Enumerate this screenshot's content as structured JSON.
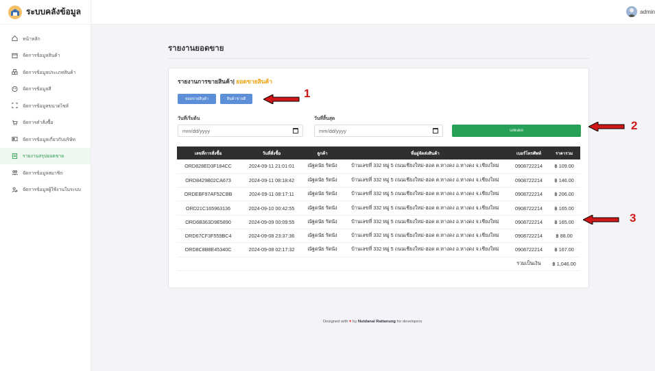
{
  "brand": {
    "title": "ระบบคลังข้อมูล"
  },
  "sidebar": {
    "items": [
      {
        "label": "หน้าหลัก",
        "icon": "home-icon",
        "active": false
      },
      {
        "label": "จัดการข้อมูลสินค้า",
        "icon": "box-icon",
        "active": false
      },
      {
        "label": "จัดการข้อมูลประเภทสินค้า",
        "icon": "boxes-icon",
        "active": false
      },
      {
        "label": "จัดการข้อมูลสี",
        "icon": "palette-icon",
        "active": false
      },
      {
        "label": "จัดการข้อมูลขนาดไซส์",
        "icon": "size-icon",
        "active": false
      },
      {
        "label": "จัดการคำสั่งซื้อ",
        "icon": "cart-icon",
        "active": false
      },
      {
        "label": "จัดการข้อมูลเกี่ยวกับบริษัท",
        "icon": "company-icon",
        "active": false
      },
      {
        "label": "รายงานสรุปยอดขาย",
        "icon": "report-icon",
        "active": true
      },
      {
        "label": "จัดการข้อมูลสมาชิก",
        "icon": "members-icon",
        "active": false
      },
      {
        "label": "จัดการข้อมูลผู้ใช้งานในระบบ",
        "icon": "user-admin-icon",
        "active": false
      }
    ]
  },
  "topbar": {
    "user": "admin"
  },
  "page": {
    "title": "รายงานยอดขาย"
  },
  "card": {
    "title": "รายงานการขายสินค้า",
    "title_highlight": "ยอดขายสินค้า",
    "btn_sales": "ยอดขายสินค้า",
    "btn_bestseller": "สินค้าขายดี",
    "start_label": "วันที่เริ่มต้น",
    "end_label": "วันที่สิ้นสุด",
    "date_placeholder": "mm/dd/yyyy",
    "show_button": "แสดงผล"
  },
  "table": {
    "headers": [
      "เลขที่การสั่งซื้อ",
      "วันที่สั่งซื้อ",
      "ลูกค้า",
      "ที่อยู่จัดส่งสินค้า",
      "เบอร์โทรศัพท์",
      "ราคารวม"
    ],
    "rows": [
      [
        "ORD828ED3F184CC",
        "2024-09-11 21:01:01",
        "ณัฐดนัย รัตนัง",
        "บ้านเลขที่ 332 หมู่ 5 ถนนเชียงใหม่-ฮอด ต.หางดง อ.หางดง จ.เชียงใหม่",
        "0908722214",
        "฿ 109.00"
      ],
      [
        "ORD8429B02CA673",
        "2024-09-11 08:18:42",
        "ณัฐดนัย รัตนัง",
        "บ้านเลขที่ 332 หมู่ 5 ถนนเชียงใหม่-ฮอด ต.หางดง อ.หางดง จ.เชียงใหม่",
        "0908722214",
        "฿ 146.00"
      ],
      [
        "ORDEBF97AF52CBB",
        "2024-09-11 08:17:11",
        "ณัฐดนัย รัตนัง",
        "บ้านเลขที่ 332 หมู่ 5 ถนนเชียงใหม่-ฮอด ต.หางดง อ.หางดง จ.เชียงใหม่",
        "0908722214",
        "฿ 206.00"
      ],
      [
        "ORD21C16596313​6",
        "2024-09-10 00:42:55",
        "ณัฐดนัย รัตนัง",
        "บ้านเลขที่ 332 หมู่ 5 ถนนเชียงใหม่-ฮอด ต.หางดง อ.หางดง จ.เชียงใหม่",
        "0908722214",
        "฿ 165.00"
      ],
      [
        "ORD6B363D9E5890",
        "2024-09-09 00:09:55",
        "ณัฐดนัย รัตนัง",
        "บ้านเลขที่ 332 หมู่ 5 ถนนเชียงใหม่-ฮอด ต.หางดง อ.หางดง จ.เชียงใหม่",
        "0908722214",
        "฿ 165.00"
      ],
      [
        "ORD67CF3F559BC4",
        "2024-09-08 23:37:36",
        "ณัฐดนัย รัตนัง",
        "บ้านเลขที่ 332 หมู่ 5 ถนนเชียงใหม่-ฮอด ต.หางดง อ.หางดง จ.เชียงใหม่",
        "0908722214",
        "฿ 88.00"
      ],
      [
        "ORD8C8B8E45340C",
        "2024-09-08 02:17:32",
        "ณัฐดนัย รัตนัง",
        "บ้านเลขที่ 332 หมู่ 5 ถนนเชียงใหม่-ฮอด ต.หางดง อ.หางดง จ.เชียงใหม่",
        "0908722214",
        "฿ 167.00"
      ]
    ],
    "total_label": "รวมเป็นเงิน",
    "total_value": "฿ 1,046.00"
  },
  "footer": {
    "prefix": "Designed with",
    "by": "by",
    "author": "Nutdanai Rattanung",
    "suffix": "for developers"
  },
  "annotations": {
    "one": "1",
    "two": "2",
    "three": "3"
  }
}
